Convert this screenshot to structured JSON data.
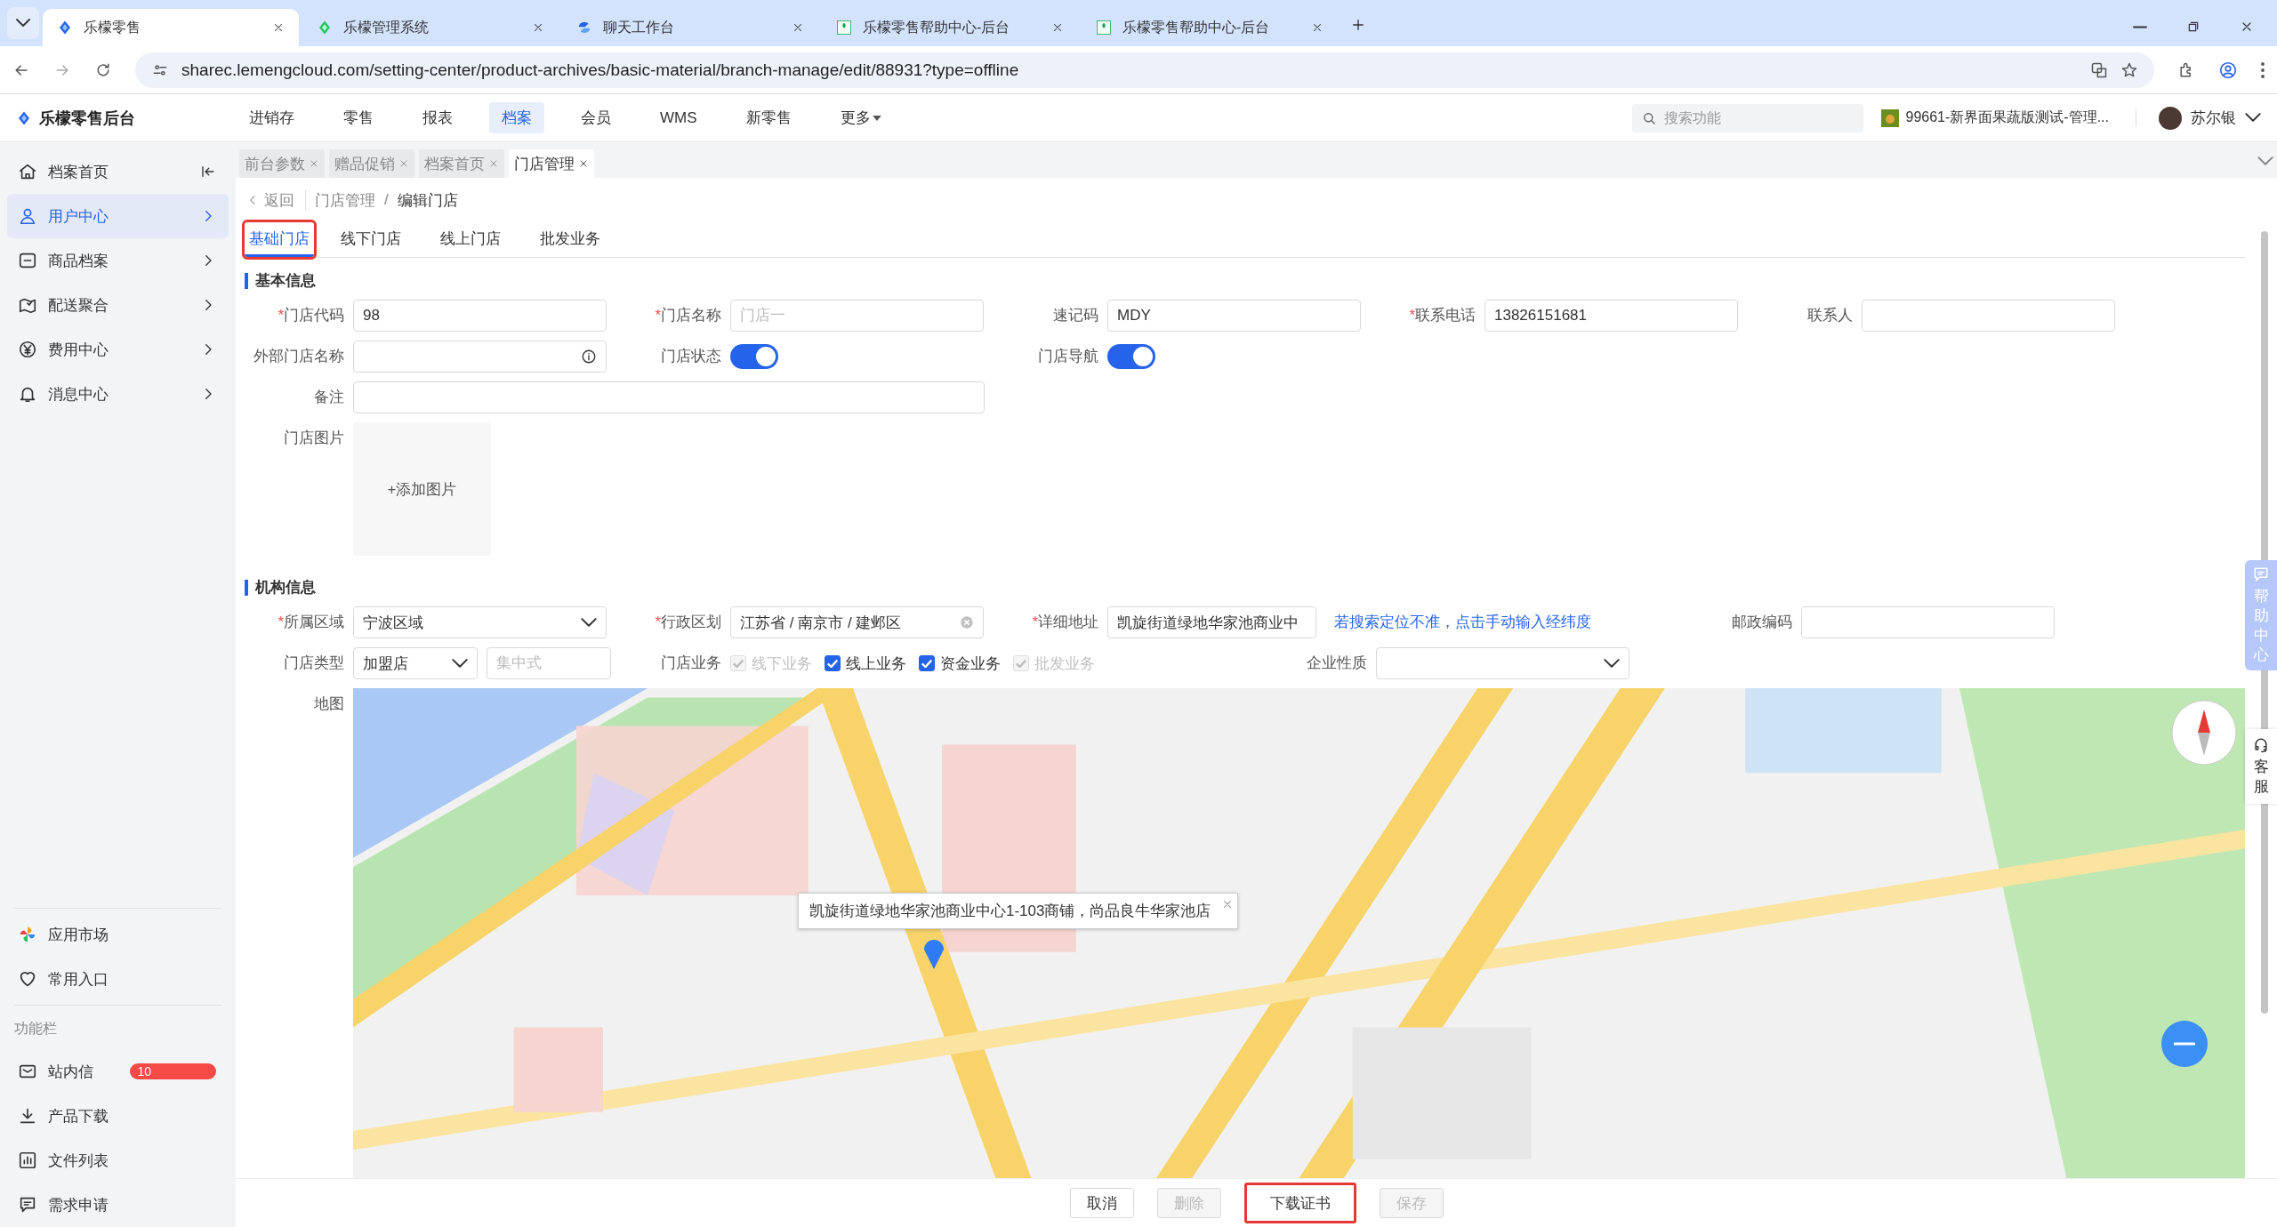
{
  "browser": {
    "tabs": [
      {
        "title": "乐檬零售",
        "selected": true
      },
      {
        "title": "乐檬管理系统",
        "selected": false
      },
      {
        "title": "聊天工作台",
        "selected": false
      },
      {
        "title": "乐檬零售帮助中心-后台",
        "selected": false
      },
      {
        "title": "乐檬零售帮助中心-后台",
        "selected": false
      }
    ],
    "url": "sharec.lemengcloud.com/setting-center/product-archives/basic-material/branch-manage/edit/88931?type=offline"
  },
  "header": {
    "brand": "乐檬零售后台",
    "nav": [
      {
        "label": "进销存",
        "selected": false
      },
      {
        "label": "零售",
        "selected": false
      },
      {
        "label": "报表",
        "selected": false
      },
      {
        "label": "档案",
        "selected": true
      },
      {
        "label": "会员",
        "selected": false
      },
      {
        "label": "WMS",
        "selected": false
      },
      {
        "label": "新零售",
        "selected": false
      },
      {
        "label": "更多",
        "selected": false
      }
    ],
    "search": {
      "placeholder": "搜索功能"
    },
    "store": "99661-新界面果蔬版测试-管理...",
    "user": "苏尔银"
  },
  "sidebar": {
    "menu": [
      {
        "label": "档案首页",
        "selected": false
      },
      {
        "label": "用户中心",
        "selected": true
      },
      {
        "label": "商品档案",
        "selected": false
      },
      {
        "label": "配送聚合",
        "selected": false
      },
      {
        "label": "费用中心",
        "selected": false
      },
      {
        "label": "消息中心",
        "selected": false
      }
    ],
    "apps": [
      {
        "label": "应用市场"
      },
      {
        "label": "常用入口"
      }
    ],
    "section_title": "功能栏",
    "tools": [
      {
        "label": "站内信",
        "badge": "10"
      },
      {
        "label": "产品下载"
      },
      {
        "label": "文件列表"
      },
      {
        "label": "需求申请"
      }
    ]
  },
  "page_tabs": [
    {
      "label": "前台参数",
      "selected": false
    },
    {
      "label": "赠品促销",
      "selected": false
    },
    {
      "label": "档案首页",
      "selected": false
    },
    {
      "label": "门店管理",
      "selected": true
    }
  ],
  "breadcrumb": {
    "back": "返回",
    "path": [
      "门店管理",
      "编辑门店"
    ],
    "separator": "/"
  },
  "form_tabs": [
    {
      "label": "基础门店",
      "selected": true,
      "annotated": true
    },
    {
      "label": "线下门店",
      "selected": false,
      "annotated": false
    },
    {
      "label": "线上门店",
      "selected": false,
      "annotated": false
    },
    {
      "label": "批发业务",
      "selected": false,
      "annotated": false
    }
  ],
  "basic_info": {
    "title": "基本信息",
    "rows": [
      [
        {
          "kind": "text",
          "label": "门店代码",
          "required_mark": "*",
          "value": "98"
        },
        {
          "kind": "text",
          "label": "门店名称",
          "required_mark": "*",
          "placeholder": "门店一"
        },
        {
          "kind": "text",
          "label": "速记码",
          "value": "MDY"
        },
        {
          "kind": "text",
          "label": "联系电话",
          "required_mark": "*",
          "value": "13826151681"
        },
        {
          "kind": "text",
          "label": "联系人"
        }
      ],
      [
        {
          "kind": "info",
          "label": "外部门店名称"
        },
        {
          "kind": "toggle",
          "label": "门店状态",
          "on": true
        },
        {
          "kind": "toggle",
          "label": "门店导航",
          "on": true
        }
      ],
      [
        {
          "kind": "remark",
          "label": "备注"
        }
      ],
      [
        {
          "kind": "upload",
          "label": "门店图片",
          "button": "+添加图片"
        }
      ]
    ]
  },
  "org_info": {
    "title": "机构信息",
    "rows": [
      [
        {
          "kind": "select",
          "label": "所属区域",
          "required_mark": "*",
          "value": "宁波区域"
        },
        {
          "kind": "cascader",
          "label": "行政区划",
          "required_mark": "*",
          "value": "江苏省 / 南京市 / 建邺区"
        },
        {
          "kind": "address",
          "label": "详细地址",
          "required_mark": "*",
          "value": "凯旋街道绿地华家池商业中",
          "link": "若搜索定位不准，点击手动输入经纬度"
        },
        {
          "kind": "text",
          "label": "邮政编码"
        }
      ],
      [
        {
          "kind": "type",
          "label": "门店类型",
          "value": "加盟店",
          "placeholder": "集中式"
        },
        {
          "kind": "checks",
          "label": "门店业务",
          "options": [
            {
              "label": "线下业务",
              "checked": true,
              "disabled": true
            },
            {
              "label": "线上业务",
              "checked": true,
              "disabled": false
            },
            {
              "label": "资金业务",
              "checked": true,
              "disabled": false
            },
            {
              "label": "批发业务",
              "checked": true,
              "disabled": true
            }
          ]
        },
        {
          "kind": "select",
          "label": "企业性质"
        }
      ]
    ],
    "map": {
      "label": "地图",
      "kind": "picture",
      "popup": "凯旋街道绿地华家池商业中心1-103商铺，尚品良牛华家池店"
    }
  },
  "actions": [
    {
      "label": "取消",
      "disabled": false,
      "annotated": false
    },
    {
      "label": "删除",
      "disabled": true,
      "annotated": false
    },
    {
      "label": "下载证书",
      "disabled": false,
      "annotated": true
    },
    {
      "label": "保存",
      "disabled": true,
      "annotated": false
    }
  ],
  "help": {
    "label": "帮助中心",
    "service": "客服"
  }
}
